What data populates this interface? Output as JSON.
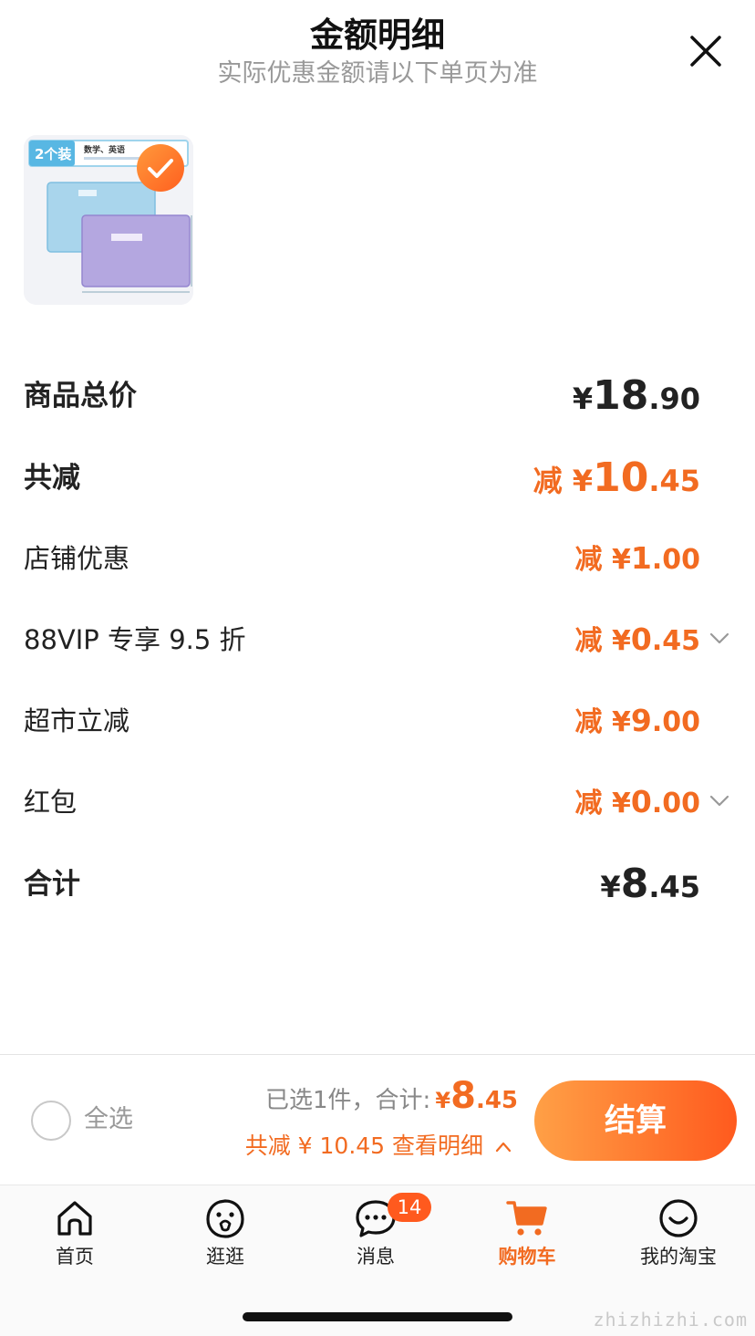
{
  "header": {
    "title": "金额明细",
    "subtitle": "实际优惠金额请以下单页为准"
  },
  "product": {
    "pack_label": "2个装",
    "package_text": "数学、英语",
    "selected": true
  },
  "rows": {
    "total_price": {
      "label": "商品总价",
      "prefix": "¥",
      "int": "18",
      "dec": ".90"
    },
    "total_discount": {
      "label": "共减",
      "prefix": "减 ¥",
      "int": "10",
      "dec": ".45"
    },
    "store_discount": {
      "label": "店铺优惠",
      "prefix": "减 ¥",
      "int": "1",
      "dec": ".00"
    },
    "vip_discount": {
      "label": "88VIP 专享 9.5 折",
      "prefix": "减 ¥",
      "int": "0",
      "dec": ".45"
    },
    "market_discount": {
      "label": "超市立减",
      "prefix": "减 ¥",
      "int": "9",
      "dec": ".00"
    },
    "red_packet": {
      "label": "红包",
      "prefix": "减 ¥",
      "int": "0",
      "dec": ".00"
    },
    "grand_total": {
      "label": "合计",
      "prefix": "¥",
      "int": "8",
      "dec": ".45"
    }
  },
  "checkout": {
    "select_all_label": "全选",
    "selected_text": "已选1件，合计:",
    "currency": "¥",
    "total_int": "8",
    "total_dec": ".45",
    "discount_text": "共减 ¥ 10.45 查看明细",
    "pay_label": "结算"
  },
  "tabbar": {
    "items": [
      {
        "label": "首页",
        "icon": "home-icon"
      },
      {
        "label": "逛逛",
        "icon": "browse-icon"
      },
      {
        "label": "消息",
        "icon": "message-icon",
        "badge": "14"
      },
      {
        "label": "购物车",
        "icon": "cart-icon",
        "active": true
      },
      {
        "label": "我的淘宝",
        "icon": "profile-icon"
      }
    ]
  },
  "watermark": "zhizhizhi.com",
  "colors": {
    "accent": "#f26b21",
    "badge": "#ff5a1e",
    "text": "#222222",
    "muted": "#999999"
  }
}
